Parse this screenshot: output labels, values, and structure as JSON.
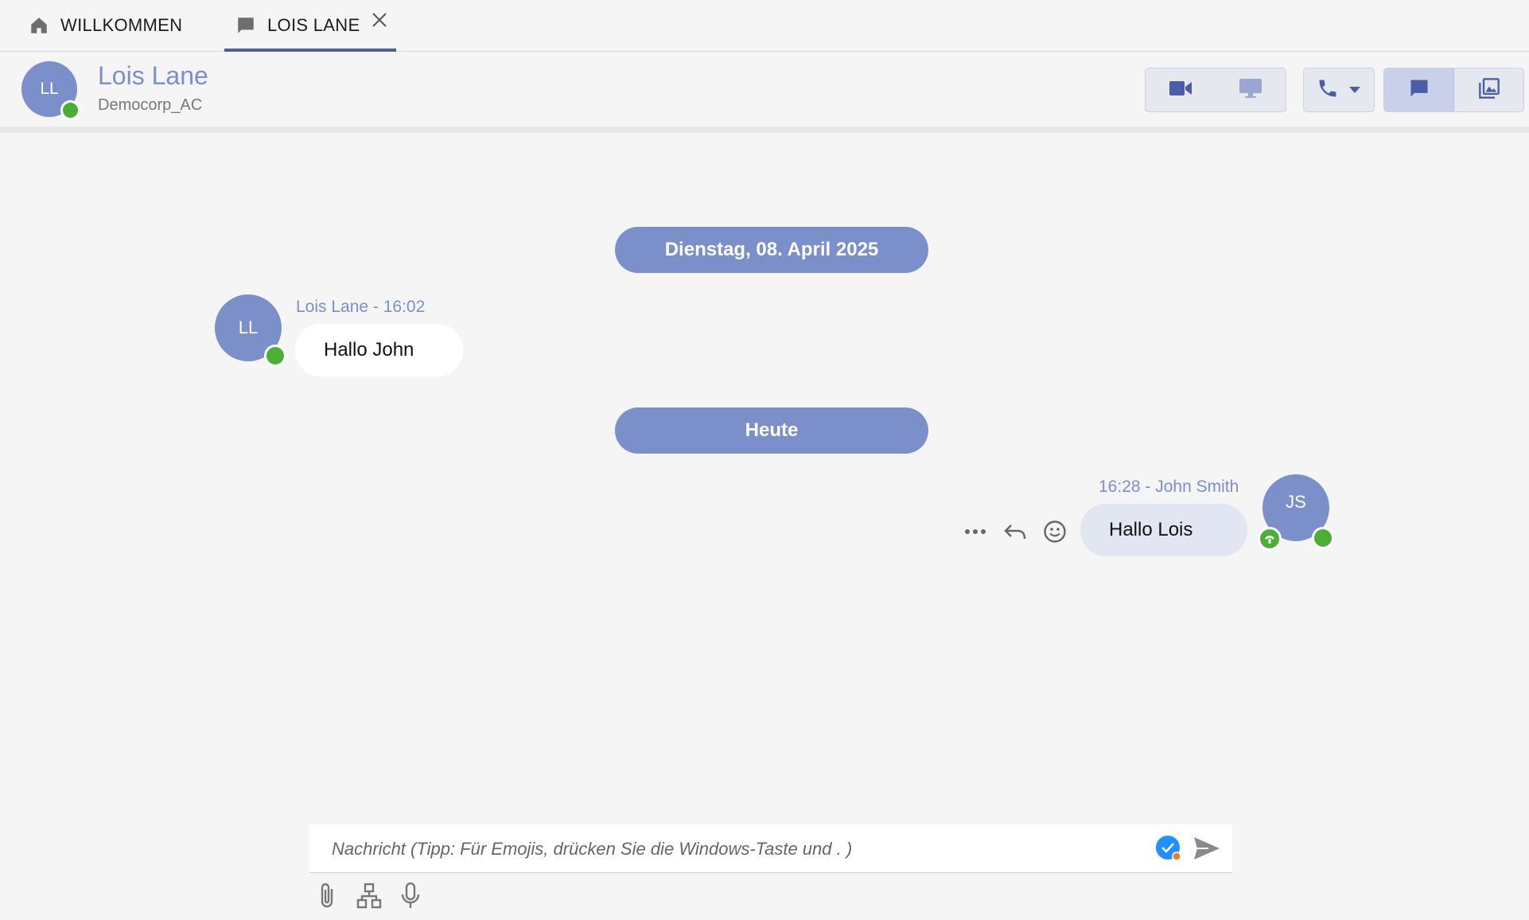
{
  "tabs": [
    {
      "label": "WILLKOMMEN",
      "icon": "home-icon"
    },
    {
      "label": "LOIS LANE",
      "icon": "chat-bubble-icon",
      "active": true
    }
  ],
  "contact": {
    "initials": "LL",
    "name": "Lois Lane",
    "organization": "Democorp_AC",
    "status": "online"
  },
  "toolbar": {
    "buttons": [
      "video-call-icon",
      "screen-share-icon",
      "phone-icon",
      "chevron-down-icon",
      "chat-icon",
      "gallery-icon"
    ]
  },
  "conversation": {
    "dates": [
      "Dienstag, 08. April 2025",
      "Heute"
    ],
    "messages": [
      {
        "direction": "in",
        "initials": "LL",
        "meta": "Lois Lane - 16:02",
        "text": "Hallo John"
      },
      {
        "direction": "out",
        "initials": "JS",
        "meta": "16:28 - John Smith",
        "text": "Hallo Lois"
      }
    ]
  },
  "composer": {
    "placeholder": "Nachricht (Tipp: Für Emojis, drücken Sie die Windows-Taste und . )",
    "value": ""
  },
  "colors": {
    "accent": "#7b8fcb",
    "online": "#4caf35",
    "tab_underline": "#4a5ea8",
    "outgoing_bubble": "#e2e6f3"
  }
}
